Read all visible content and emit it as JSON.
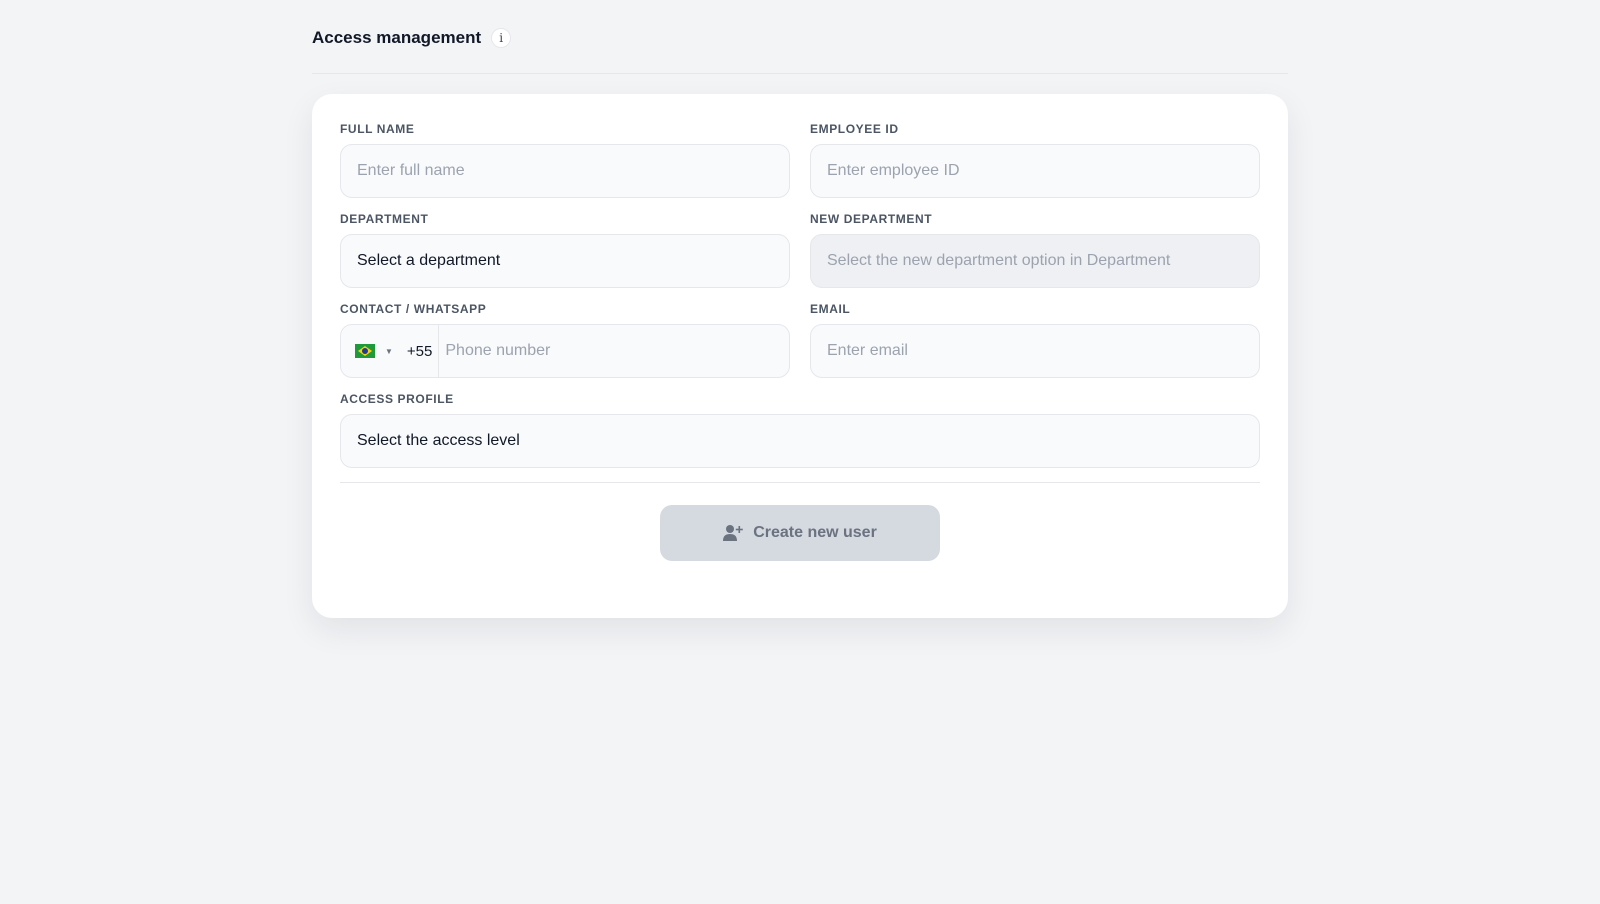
{
  "header": {
    "title": "Access management",
    "info_icon": "i"
  },
  "form": {
    "full_name": {
      "label": "FULL NAME",
      "placeholder": "Enter full name"
    },
    "employee_id": {
      "label": "EMPLOYEE ID",
      "placeholder": "Enter employee ID"
    },
    "department": {
      "label": "DEPARTMENT",
      "value": "Select a department"
    },
    "new_department": {
      "label": "NEW DEPARTMENT",
      "placeholder": "Select the new department option in Department"
    },
    "contact": {
      "label": "CONTACT / WHATSAPP",
      "country": "brazil-flag-icon",
      "dial_code": "+55",
      "placeholder": "Phone number"
    },
    "email": {
      "label": "EMAIL",
      "placeholder": "Enter email"
    },
    "access_profile": {
      "label": "ACCESS PROFILE",
      "value": "Select the access level"
    }
  },
  "actions": {
    "create_label": "Create new user",
    "create_icon": "user-plus-icon"
  }
}
